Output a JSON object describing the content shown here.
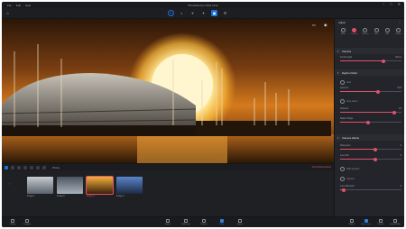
{
  "app": {
    "title": "PhotoDirector 2024 Ultra",
    "menu": [
      "File",
      "Edit",
      "Help"
    ],
    "window_controls": [
      "−",
      "□",
      "✕"
    ]
  },
  "toolbar": {
    "left_icon": "⌂",
    "tools": [
      {
        "name": "edit-icon",
        "glyph": "✎"
      },
      {
        "name": "adjust-icon",
        "glyph": "◐"
      },
      {
        "name": "crop-icon",
        "glyph": "⌖"
      },
      {
        "name": "heal-icon",
        "glyph": "✦"
      },
      {
        "name": "layers-icon",
        "glyph": "▣"
      },
      {
        "name": "settings-icon",
        "glyph": "⚙"
      }
    ]
  },
  "canvas": {
    "compare_icon": "▭",
    "eye_icon": "◉"
  },
  "filmstrip": {
    "label": "Photos",
    "right_action": "Add photos/videos",
    "items": [
      {
        "label": "Image 1",
        "colors": [
          "#c7ccd2",
          "#5a616b"
        ],
        "selected": false
      },
      {
        "label": "Image 2",
        "colors": [
          "#4b5560",
          "#a7b0ba"
        ],
        "selected": false
      },
      {
        "label": "Image 3",
        "colors": [
          "#f5b03a",
          "#3b1f0d"
        ],
        "selected": true
      },
      {
        "label": "Image 4",
        "colors": [
          "#5a86c9",
          "#1e2a44"
        ],
        "selected": false
      }
    ]
  },
  "panel": {
    "title": "Adjust",
    "tabs": [
      {
        "label": "Basic",
        "active": false
      },
      {
        "label": "Creative",
        "active": true
      },
      {
        "label": "Presets",
        "active": false
      },
      {
        "label": "Tone",
        "active": false
      },
      {
        "label": "HSL",
        "active": false
      },
      {
        "label": "Details",
        "active": false
      }
    ],
    "sections": [
      {
        "title": "Camera"
      },
      {
        "title": "Depth of field"
      },
      {
        "title": "Camera effects"
      }
    ],
    "sliders": [
      {
        "label": "Focal length",
        "value": "50mm",
        "level": 0.7
      },
      {
        "label": "Aperture",
        "value": "f/2.8",
        "level": 0.62
      },
      {
        "label": "Distance",
        "value": "1.9",
        "level": 0.88
      },
      {
        "label": "Bokeh Shape",
        "value": "",
        "level": 0.45
      },
      {
        "label": "Sharpness",
        "value": "0",
        "level": 0.58
      },
      {
        "label": "Lens blur",
        "value": "0",
        "level": 0.58
      },
      {
        "label": "Lens Distortion",
        "value": "0",
        "level": 0.06
      }
    ],
    "toggles": [
      "Auto",
      "Face detect",
      "High dynamic",
      "Vignette"
    ]
  },
  "bottombar": {
    "left": [
      {
        "label": "Library"
      },
      {
        "label": "Compare"
      }
    ],
    "center": [
      {
        "label": "Import",
        "active": false
      },
      {
        "label": "Slideshow",
        "active": false
      },
      {
        "label": "Projects",
        "active": false
      },
      {
        "label": "Editor",
        "active": true
      },
      {
        "label": "Export",
        "active": false
      }
    ],
    "right": [
      {
        "label": "Effects",
        "active": false
      },
      {
        "label": "Adjustment",
        "active": true
      },
      {
        "label": "Presets",
        "active": false
      },
      {
        "label": "Guided Edits",
        "active": false
      }
    ]
  }
}
